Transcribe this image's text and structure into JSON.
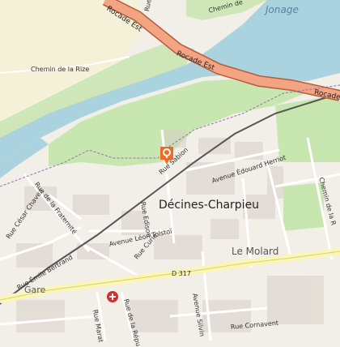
{
  "map": {
    "place_labels": {
      "city": "Décines-Charpieu",
      "district": "Le Molard",
      "station": "Gare",
      "water": "Jonage"
    },
    "road_labels": {
      "rocade_est_1": "Rocade Est",
      "rocade_est_2": "Rocade Est",
      "rocade_est_3": "Rocade Est",
      "chemin_rize": "Chemin de la Rize",
      "chemin_de_top": "Chemin de",
      "rue_de_top": "Rue de",
      "rue_sabion": "Rue Sabion",
      "avenue_herriot": "Avenue Édouard Herriot",
      "chemin_de_la_r": "Chemin de la R",
      "rue_edison": "Rue Edison",
      "avenue_tolstoi": "Avenue Léon Tolstoï",
      "rue_fraternite": "Rue de la Fraternité",
      "rue_chavez": "Rue César Chavez",
      "rue_bertrand": "Rue Émile Bertrand",
      "rue_curie": "Rue Curie",
      "d317": "D 317",
      "avenue_silvin": "Avenue Silvin",
      "rue_cornavent": "Rue Cornavent",
      "rue_de_la_repu": "Rue de la Répu",
      "rue_marat": "Rue Marat"
    },
    "marker_icon": "location-pin-icon",
    "pharmacy_icon": "pharmacy-cross-icon",
    "colors": {
      "water": "#aad3df",
      "motorway": "#f2a483",
      "main_road": "#f9f6b6",
      "park": "#c9e5b3",
      "marker": "#f26b25",
      "pharmacy": "#d32f2f"
    }
  }
}
